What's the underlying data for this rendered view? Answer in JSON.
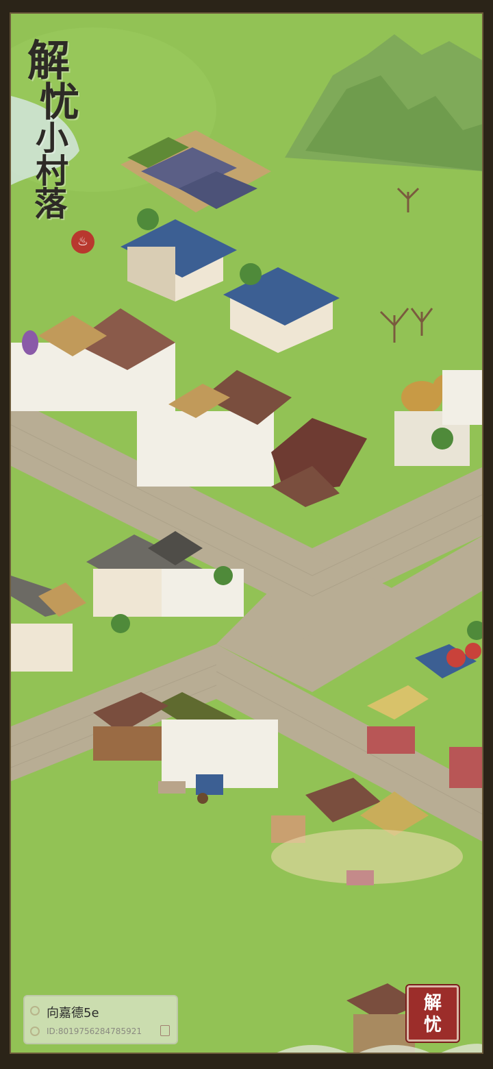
{
  "game": {
    "title_chars": [
      "解",
      "忧",
      "小",
      "村",
      "落"
    ],
    "logo_seal": "♨"
  },
  "player": {
    "name": "向嘉德5e",
    "id": "ID:8019756284785921"
  },
  "menu_button": {
    "chars": [
      "解",
      "忧"
    ]
  },
  "colors": {
    "grass": "#8fbf52",
    "road": "#b8ad94",
    "frame": "#2b2418",
    "button_red": "#9c2d2a"
  }
}
